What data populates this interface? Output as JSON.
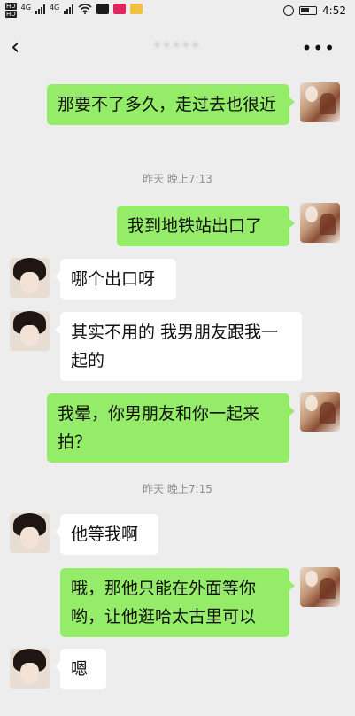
{
  "status_bar": {
    "hd_labels": [
      "HD",
      "HD"
    ],
    "network_labels": [
      "4G",
      "4G"
    ],
    "time": "4:52"
  },
  "header": {
    "title": "•••••",
    "back_icon": "chevron-left-icon",
    "more_label": "•••"
  },
  "messages": [
    {
      "type": "sent",
      "text": "那要不了多久，走过去也很近"
    },
    {
      "type": "timestamp",
      "text": "昨天 晚上7:13"
    },
    {
      "type": "sent",
      "text": "我到地铁站出口了"
    },
    {
      "type": "recv",
      "text": "哪个出口呀"
    },
    {
      "type": "recv",
      "text": "其实不用的 我男朋友跟我一起的"
    },
    {
      "type": "sent",
      "text": "我晕，你男朋友和你一起来拍？"
    },
    {
      "type": "timestamp",
      "text": "昨天 晚上7:15"
    },
    {
      "type": "recv",
      "text": "他等我啊"
    },
    {
      "type": "sent",
      "text": "哦，那他只能在外面等你哟，让他逛哈太古里可以"
    },
    {
      "type": "recv",
      "text": "嗯"
    }
  ],
  "colors": {
    "background": "#ededed",
    "sent_bubble": "#95ec69",
    "recv_bubble": "#ffffff",
    "timestamp_text": "#8f8f8f"
  }
}
